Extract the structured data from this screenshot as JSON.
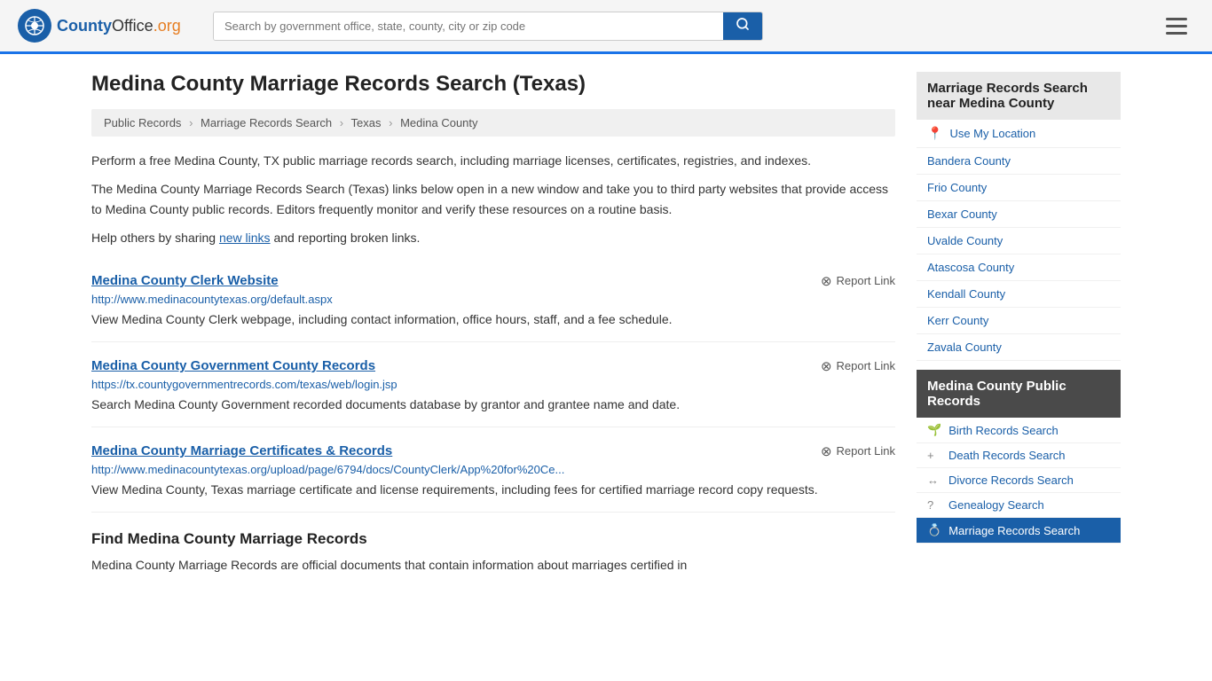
{
  "header": {
    "logo_text": "CountyOffice",
    "logo_org": ".org",
    "search_placeholder": "Search by government office, state, county, city or zip code"
  },
  "page": {
    "title": "Medina County Marriage Records Search (Texas)"
  },
  "breadcrumb": {
    "items": [
      "Public Records",
      "Marriage Records Search",
      "Texas",
      "Medina County"
    ]
  },
  "content": {
    "description1": "Perform a free Medina County, TX public marriage records search, including marriage licenses, certificates, registries, and indexes.",
    "description2": "The Medina County Marriage Records Search (Texas) links below open in a new window and take you to third party websites that provide access to Medina County public records. Editors frequently monitor and verify these resources on a routine basis.",
    "description3_pre": "Help others by sharing ",
    "description3_link": "new links",
    "description3_post": " and reporting broken links.",
    "results": [
      {
        "title": "Medina County Clerk Website",
        "url": "http://www.medinacountytexas.org/default.aspx",
        "desc": "View Medina County Clerk webpage, including contact information, office hours, staff, and a fee schedule.",
        "report_label": "Report Link"
      },
      {
        "title": "Medina County Government County Records",
        "url": "https://tx.countygovernmentrecords.com/texas/web/login.jsp",
        "desc": "Search Medina County Government recorded documents database by grantor and grantee name and date.",
        "report_label": "Report Link"
      },
      {
        "title": "Medina County Marriage Certificates & Records",
        "url": "http://www.medinacountytexas.org/upload/page/6794/docs/CountyClerk/App%20for%20Ce...",
        "desc": "View Medina County, Texas marriage certificate and license requirements, including fees for certified marriage record copy requests.",
        "report_label": "Report Link"
      }
    ],
    "section_heading": "Find Medina County Marriage Records",
    "section_desc": "Medina County Marriage Records are official documents that contain information about marriages certified in"
  },
  "sidebar": {
    "nearby_title": "Marriage Records Search near Medina County",
    "location_label": "Use My Location",
    "nearby_counties": [
      "Bandera County",
      "Frio County",
      "Bexar County",
      "Uvalde County",
      "Atascosa County",
      "Kendall County",
      "Kerr County",
      "Zavala County"
    ],
    "public_records_title": "Medina County Public Records",
    "public_records_items": [
      {
        "icon": "🌱",
        "label": "Birth Records Search"
      },
      {
        "icon": "+",
        "label": "Death Records Search"
      },
      {
        "icon": "↔",
        "label": "Divorce Records Search"
      },
      {
        "icon": "?",
        "label": "Genealogy Search"
      },
      {
        "icon": "💍",
        "label": "Marriage Records Search"
      }
    ]
  }
}
